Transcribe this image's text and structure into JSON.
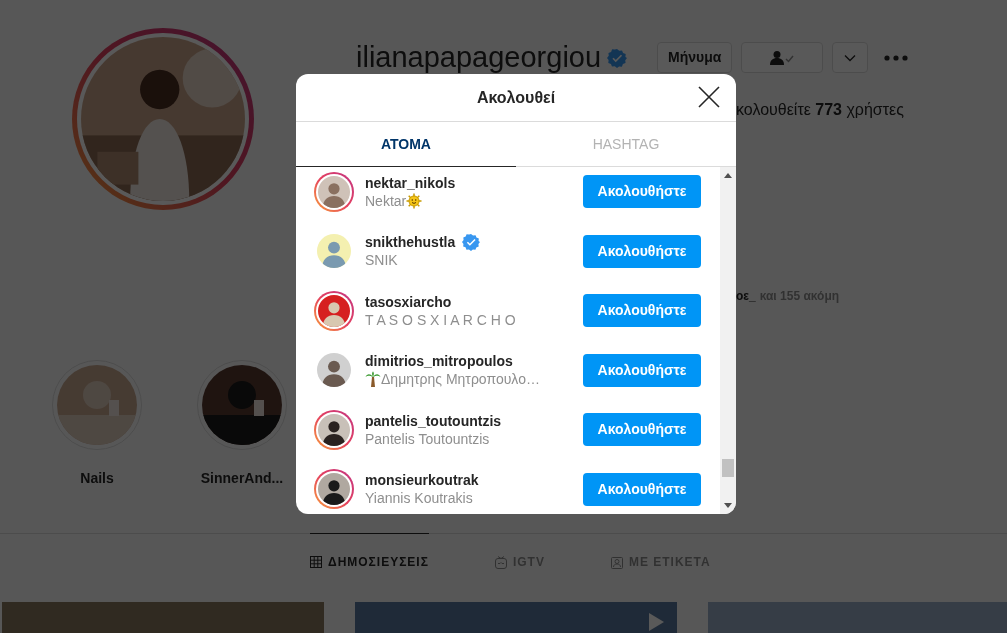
{
  "profile": {
    "username": "ilianapapageorgiou",
    "verified": true,
    "message_button": "Μήνυμα",
    "stats_text": "κολουθείτε **773** χρήστες",
    "followed_by_name": "οε_",
    "followed_by_rest": "και 155 ακόμη"
  },
  "highlights": [
    {
      "label": "Nails"
    },
    {
      "label": "SinnerAnd..."
    }
  ],
  "profile_tabs": [
    {
      "label": "ΔΗΜΟΣΙΕΥΣΕΙΣ",
      "selected": true,
      "kind": "grid"
    },
    {
      "label": "IGTV",
      "selected": false,
      "kind": "tv"
    },
    {
      "label": "ΜΕ ΕΤΙΚΕΤΑ",
      "selected": false,
      "kind": "tag"
    }
  ],
  "posts": [
    {
      "kind": "picture"
    },
    {
      "kind": "video"
    },
    {
      "kind": "picture"
    }
  ],
  "modal": {
    "title": "Ακολουθεί",
    "tabs": [
      {
        "label": "ΑΤΟΜΑ",
        "selected": true
      },
      {
        "label": "HASHTAG",
        "selected": false
      }
    ],
    "users": [
      {
        "username": "nektar_nikols",
        "full_name": "Nektar",
        "sun_emoji_after": true,
        "verified": false,
        "story": true,
        "button": "Ακολουθήστε"
      },
      {
        "username": "snikthehustla",
        "full_name": "SNIK",
        "verified": true,
        "story": false,
        "button": "Ακολουθήστε"
      },
      {
        "username": "tasosxiarcho",
        "full_name": "T A S O S X I A R C H O",
        "verified": false,
        "story": true,
        "button": "Ακολουθήστε"
      },
      {
        "username": "dimitrios_mitropoulos",
        "full_name": "Δημητρης Μητροπουλο…",
        "palm_emoji_before": true,
        "verified": false,
        "story": false,
        "button": "Ακολουθήστε"
      },
      {
        "username": "pantelis_toutountzis",
        "full_name": "Pantelis Toutountzis",
        "verified": false,
        "story": true,
        "button": "Ακολουθήστε"
      },
      {
        "username": "monsieurkoutrak",
        "full_name": "Yiannis Koutrakis",
        "verified": false,
        "story": true,
        "button": "Ακολουθήστε"
      }
    ]
  }
}
